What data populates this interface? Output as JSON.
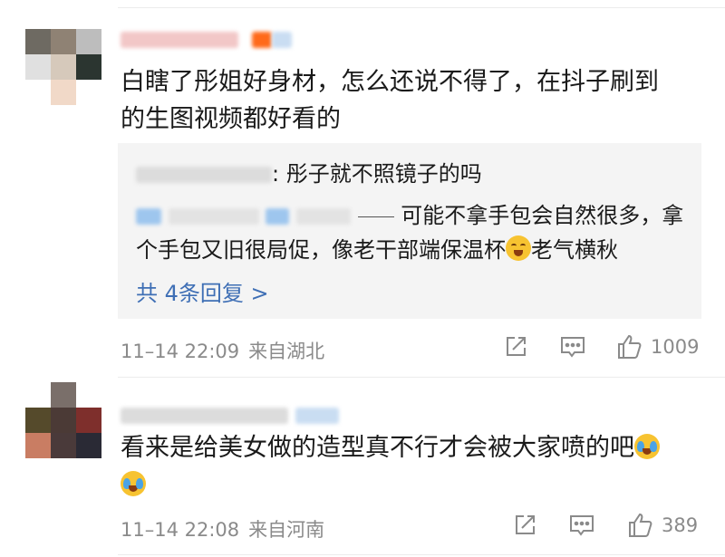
{
  "comments": [
    {
      "text_line1": "白瞎了彤姐好身材，怎么还说不得了，在抖子刷到",
      "text_line2": "的生图视频都好看的",
      "replies": [
        {
          "text": ": 彤子就不照镜子的吗"
        },
        {
          "text_line1": "可能不拿手包会自然很多，拿",
          "text_line2a": "个手包又旧很局促，像老干部端保温杯",
          "text_line2b": "老气横秋"
        }
      ],
      "more_replies": "共 4条回复 >",
      "time": "11–14 22:09",
      "location": "来自湖北",
      "likes": "1009"
    },
    {
      "text_line1": "看来是给美女做的造型真不行才会被大家喷的吧",
      "time": "11–14 22:08",
      "location": "来自河南",
      "likes": "389"
    }
  ],
  "colors": {
    "link": "#3f6fb5",
    "meta": "#8a8a8a",
    "reply_bg": "#f4f4f4"
  },
  "icons": [
    "share-icon",
    "comment-icon",
    "like-icon",
    "cry-emoji",
    "smile-emoji"
  ]
}
